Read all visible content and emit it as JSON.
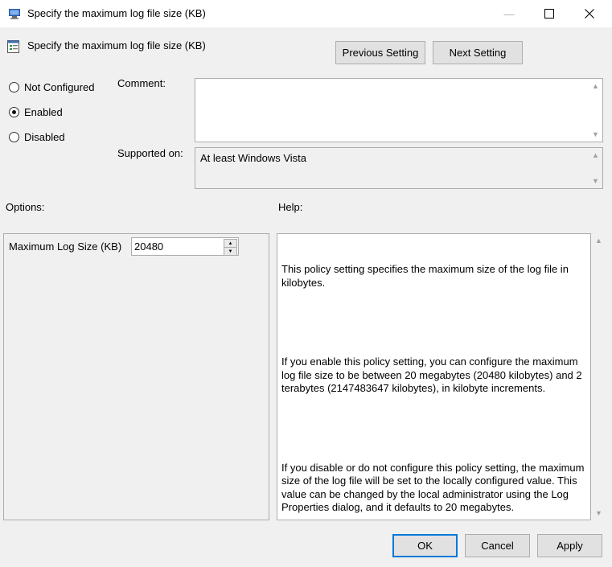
{
  "window": {
    "title": "Specify the maximum log file size (KB)",
    "minimize_glyph": "—",
    "maximize_glyph": "☐",
    "close_glyph": "✕"
  },
  "header": {
    "setting_name": "Specify the maximum log file size (KB)",
    "previous_label": "Previous Setting",
    "next_label": "Next Setting"
  },
  "state": {
    "options": [
      "Not Configured",
      "Enabled",
      "Disabled"
    ],
    "selected": "Enabled"
  },
  "comment": {
    "label": "Comment:",
    "value": ""
  },
  "supported": {
    "label": "Supported on:",
    "value": "At least Windows Vista"
  },
  "options_panel": {
    "label": "Options:",
    "field_label": "Maximum Log Size (KB)",
    "field_value": "20480"
  },
  "help": {
    "label": "Help:",
    "paragraphs": [
      "This policy setting specifies the maximum size of the log file in kilobytes.",
      "If you enable this policy setting, you can configure the maximum log file size to be between 20 megabytes (20480 kilobytes) and 2 terabytes (2147483647 kilobytes), in kilobyte increments.",
      "If you disable or do not configure this policy setting, the maximum size of the log file will be set to the locally configured value. This value can be changed by the local administrator using the Log Properties dialog, and it defaults to 20 megabytes."
    ]
  },
  "footer": {
    "ok_label": "OK",
    "cancel_label": "Cancel",
    "apply_label": "Apply"
  },
  "colors": {
    "accent": "#0078d7",
    "face": "#f0f0f0",
    "button": "#e1e1e1"
  },
  "icons": [
    "policy-app-icon",
    "policy-setting-icon",
    "minimize-icon",
    "maximize-icon",
    "close-icon",
    "spin-up-icon",
    "spin-down-icon"
  ]
}
